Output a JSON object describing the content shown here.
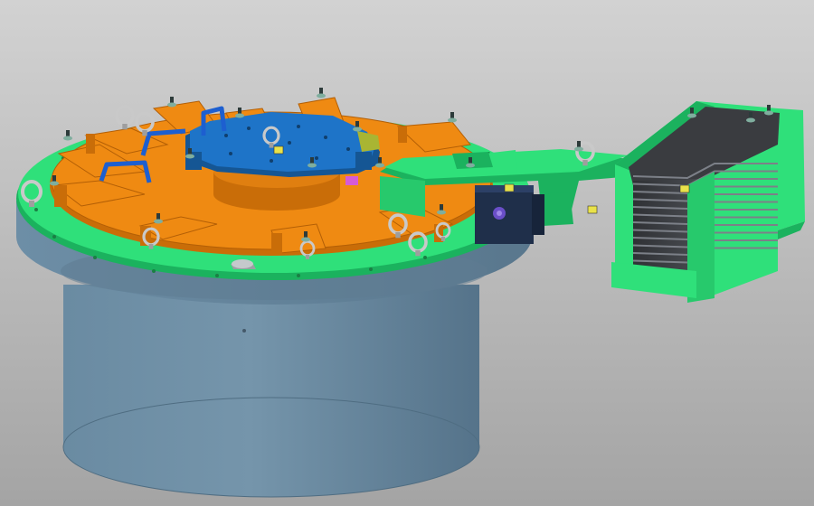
{
  "viewport": {
    "background_top": "#d2d2d2",
    "background_bottom": "#a4a4a4"
  },
  "colors": {
    "cylinder_body": "#6e8fa6",
    "cylinder_shadow": "#4f6d82",
    "flange_green": "#2fe07a",
    "flange_edge": "#1bb25e",
    "fixture_orange": "#ef8a12",
    "fixture_orange_dark": "#c96d08",
    "center_plate_blue": "#1e74c8",
    "center_plate_dark": "#155694",
    "handle_blue": "#1d5fd0",
    "lifting_eye": "#c9c9c9",
    "bolt_dark": "#2d3b3a",
    "heatsink_dark": "#3a3c40",
    "heatsink_fin": "#7c8088",
    "bracket_navy": "#1f2f4a",
    "knob_purple": "#6a4fc8",
    "accent_magenta": "#d65bd6",
    "accent_olive": "#a9b533",
    "label_yellow": "#e9e24a"
  },
  "icons": {
    "lifting_eye": "ring-bolt-icon",
    "bolt": "hex-bolt-icon"
  },
  "counts": {
    "fixture_arms": 10,
    "lifting_eyes": 8,
    "heatsink_fins": 12
  }
}
